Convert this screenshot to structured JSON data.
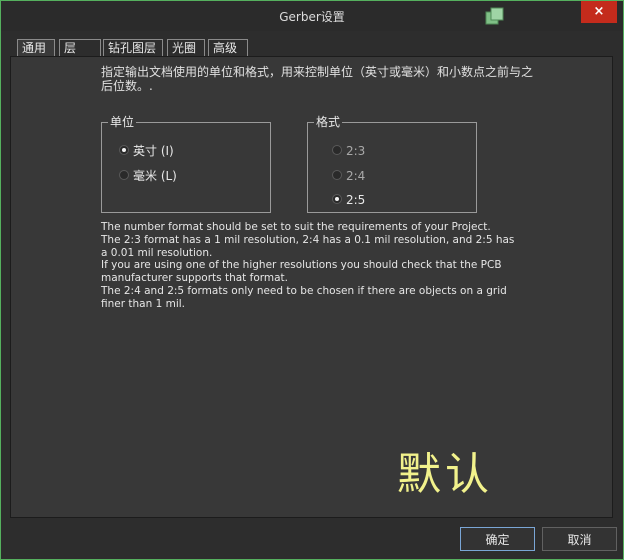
{
  "window": {
    "title": "Gerber设置",
    "close_icon": "×"
  },
  "tabs": [
    {
      "label": "通用"
    },
    {
      "label": "层"
    },
    {
      "label": "钻孔图层"
    },
    {
      "label": "光圈"
    },
    {
      "label": "高级"
    }
  ],
  "description": "指定输出文档使用的单位和格式，用来控制单位（英寸或毫米）和小数点之前与之后位数。.",
  "units_group": {
    "legend": "单位",
    "options": [
      {
        "label": "英寸 (I)",
        "checked": true
      },
      {
        "label": "毫米 (L)",
        "checked": false
      }
    ]
  },
  "format_group": {
    "legend": "格式",
    "options": [
      {
        "label": "2:3",
        "checked": false,
        "enabled": false
      },
      {
        "label": "2:4",
        "checked": false,
        "enabled": false
      },
      {
        "label": "2:5",
        "checked": true,
        "enabled": true
      }
    ]
  },
  "info": {
    "line1": "The number format should be set to suit the requirements of your Project.",
    "line2": "The 2:3 format has a 1 mil resolution, 2:4 has a 0.1 mil resolution, and 2:5 has a 0.01 mil resolution.",
    "line3": "If you are using one of the higher resolutions you should check that the PCB manufacturer supports that format.",
    "line4": "The 2:4 and 2:5 formats only need to be chosen if there are objects on a grid finer than 1 mil."
  },
  "default_label": "默认",
  "buttons": {
    "ok": "确定",
    "cancel": "取消"
  },
  "colors": {
    "background": "#2d2d2d",
    "panel": "#383838",
    "close_button": "#c42b1c",
    "default_text": "#f2f28c",
    "window_border": "#55b05e"
  }
}
